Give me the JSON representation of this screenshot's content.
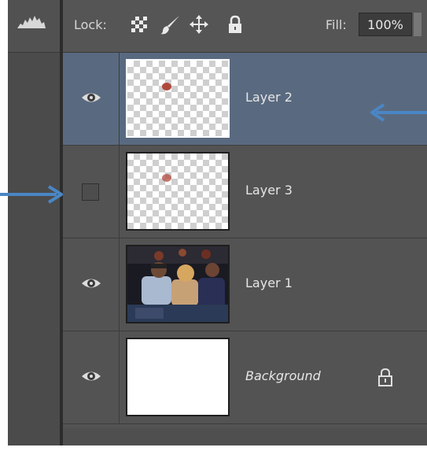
{
  "lock_bar": {
    "label": "Lock:",
    "icons": [
      "lock-transparent-pixels-icon",
      "lock-image-pixels-icon",
      "lock-position-icon",
      "lock-all-icon"
    ],
    "fill_label": "Fill:",
    "fill_value": "100%"
  },
  "layers": [
    {
      "name": "Layer 2",
      "visible": true,
      "selected": true,
      "thumbnail": "transparent-with-dot"
    },
    {
      "name": "Layer 3",
      "visible": false,
      "selected": false,
      "thumbnail": "transparent-with-dot"
    },
    {
      "name": "Layer 1",
      "visible": true,
      "selected": false,
      "thumbnail": "photo"
    },
    {
      "name": "Background",
      "visible": true,
      "selected": false,
      "thumbnail": "white",
      "locked": true
    }
  ],
  "colors": {
    "panel_bg": "#535353",
    "selected_row": "#596a80",
    "annotation_arrow": "#4a86c5"
  }
}
